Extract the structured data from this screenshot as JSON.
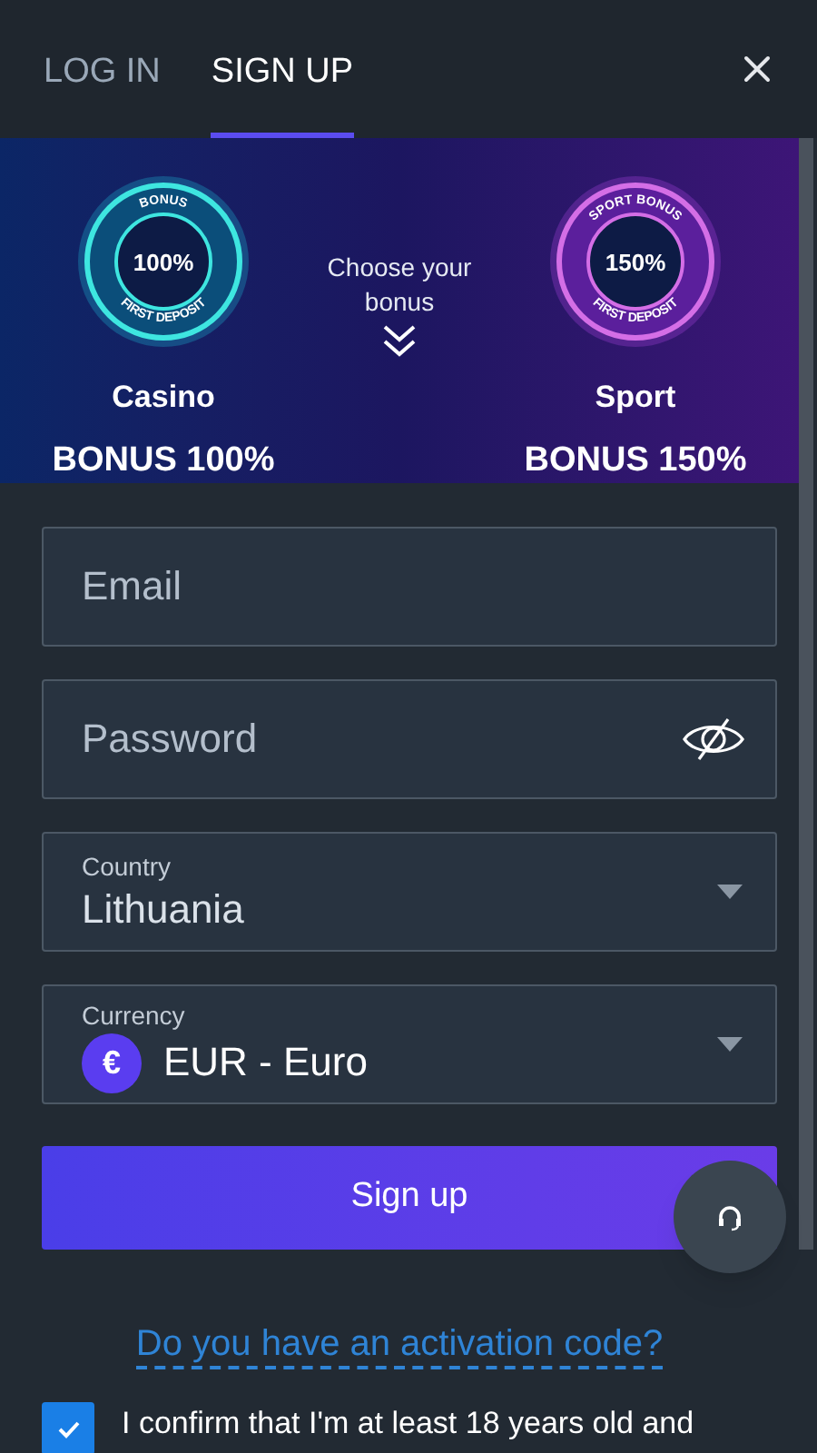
{
  "tabs": [
    {
      "label": "LOG IN",
      "selected": false
    },
    {
      "label": "SIGN UP",
      "selected": true
    }
  ],
  "banner": {
    "prompt": "Choose your bonus",
    "offers": [
      {
        "kind": "casino",
        "badge_top": "BONUS",
        "badge_value": "100%",
        "badge_bottom": "FIRST DEPOSIT",
        "title": "Casino",
        "bonus": "BONUS 100%"
      },
      {
        "kind": "sport",
        "badge_top": "SPORT BONUS",
        "badge_value": "150%",
        "badge_bottom": "FIRST DEPOSIT",
        "title": "Sport",
        "bonus": "BONUS 150%"
      }
    ]
  },
  "fields": [
    {
      "kind": "text",
      "placeholder": "Email"
    },
    {
      "kind": "password",
      "placeholder": "Password"
    },
    {
      "kind": "select",
      "label": "Country",
      "value": "Lithuania"
    },
    {
      "kind": "currency",
      "label": "Currency",
      "value": "EUR - Euro",
      "symbol": "€"
    }
  ],
  "submit": "Sign up",
  "activation_link": "Do you have an activation code?",
  "consent": {
    "checked": true,
    "text": "I confirm that I'm at least 18 years old and"
  }
}
